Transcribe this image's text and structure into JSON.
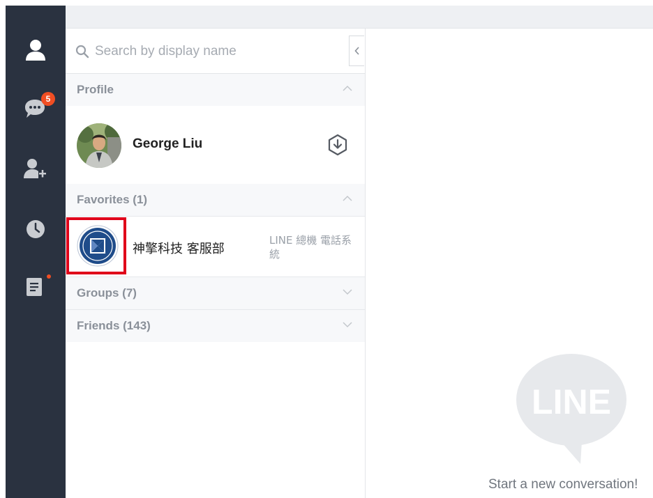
{
  "sidebar": {
    "items": [
      {
        "icon": "person-icon"
      },
      {
        "icon": "chat-icon",
        "badge": "5"
      },
      {
        "icon": "add-friend-icon"
      },
      {
        "icon": "clock-icon"
      },
      {
        "icon": "note-icon"
      }
    ]
  },
  "search": {
    "placeholder": "Search by display name"
  },
  "sections": {
    "profile": "Profile",
    "favorites": "Favorites (1)",
    "groups": "Groups (7)",
    "friends": "Friends (143)"
  },
  "profile": {
    "name": "George Liu"
  },
  "favorites": [
    {
      "name": "神擎科技 客服部",
      "status": "LINE 總機 電話系統"
    }
  ],
  "main": {
    "logo_text": "LINE",
    "empty_text": "Start a new conversation!"
  },
  "colors": {
    "sidebar_bg": "#2a3240",
    "badge": "#f04e23",
    "highlight": "#e0001a"
  }
}
